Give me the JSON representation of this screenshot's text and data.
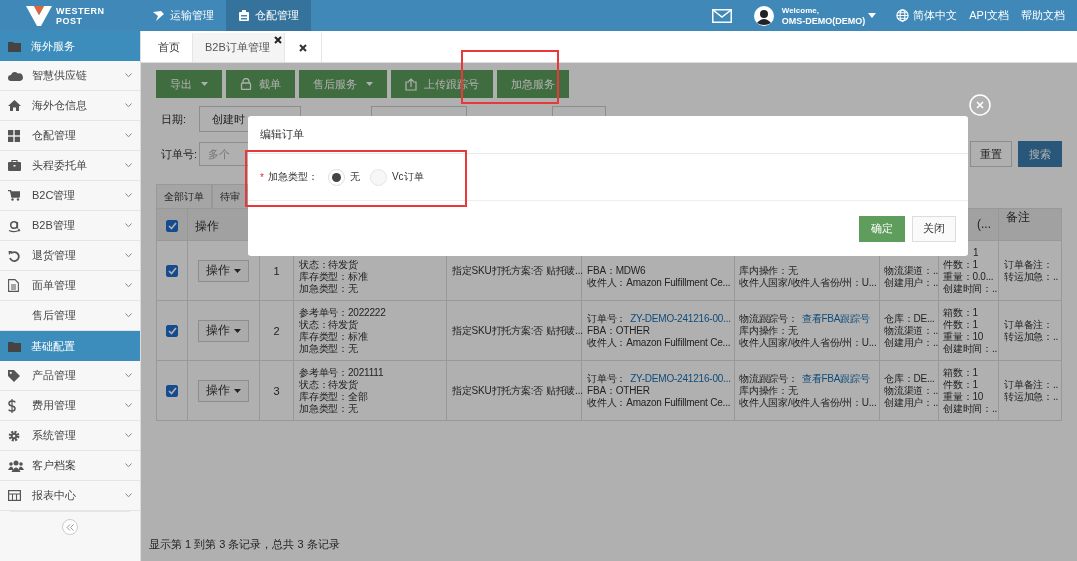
{
  "header": {
    "logo_line1": "WESTERN",
    "logo_line2": "POST",
    "nav": [
      {
        "label": "运输管理",
        "selected": false
      },
      {
        "label": "仓配管理",
        "selected": true
      }
    ],
    "welcome": "Welcome,",
    "user": "OMS-DEMO(DEMO)",
    "language": "简体中文",
    "links": [
      "API文档",
      "帮助文档"
    ]
  },
  "sidebar": {
    "groups": [
      {
        "title": "海外服务",
        "items": [
          "智慧供应链",
          "海外仓信息",
          "仓配管理",
          "头程委托单",
          "B2C管理",
          "B2B管理",
          "退货管理",
          "面单管理",
          "售后管理"
        ]
      },
      {
        "title": "基础配置",
        "items": [
          "产品管理",
          "费用管理",
          "系统管理",
          "客户档案",
          "报表中心"
        ]
      }
    ]
  },
  "tabs": [
    {
      "label": "首页",
      "selected": false,
      "closable": false
    },
    {
      "label": "B2B订单管理",
      "selected": true,
      "closable": true
    }
  ],
  "toolbar": [
    {
      "label": "导出",
      "dropdown": true
    },
    {
      "label": "截单",
      "dropdown": false
    },
    {
      "label": "售后服务",
      "dropdown": true
    },
    {
      "label": "上传跟踪号",
      "dropdown": false
    },
    {
      "label": "加急服务",
      "dropdown": false
    }
  ],
  "filters": {
    "date_label": "日期:",
    "date_type": "创建时",
    "order_label": "订单号:",
    "order_placeholder": "多个",
    "reset": "重置",
    "search": "搜索"
  },
  "status_tabs": [
    {
      "label": "全部订单"
    },
    {
      "label": "待审"
    }
  ],
  "table": {
    "header_checked": true,
    "header": {
      "actions": "操作",
      "count": "(...",
      "remark": "备注"
    },
    "rows": [
      {
        "checked": true,
        "action": "操作",
        "number": "1",
        "ref": [
          {
            "text": "状态：待发货"
          },
          {
            "text": "库存类型：标准"
          },
          {
            "text": "加急类型：无"
          }
        ],
        "sku": [
          {
            "text": "指定SKU打托方案:否 贴托唛..."
          }
        ],
        "order": [
          {
            "text": "FBA：MDW6"
          },
          {
            "text": "收件人：Amazon Fulfillment Ce..."
          }
        ],
        "logistics": [
          {
            "text": "库内操作：无"
          },
          {
            "text": "收件人国家/收件人省份/州：U..."
          }
        ],
        "warehouse": [
          {
            "text": "物流渠道：.."
          },
          {
            "text": "创建用户：.."
          }
        ],
        "counts": [
          {
            "value": "1"
          },
          {
            "label": "件数：",
            "value": "1"
          },
          {
            "label": "重量：",
            "value": "0.0..."
          },
          {
            "label": "创建时间：",
            "value": ".."
          }
        ],
        "remark": [
          {
            "text": "订单备注："
          },
          {
            "text": "转运加急：.."
          }
        ]
      },
      {
        "checked": true,
        "action": "操作",
        "number": "2",
        "ref": [
          {
            "text": "参考单号：2022222"
          },
          {
            "text": "状态：待发货"
          },
          {
            "text": "库存类型：标准"
          },
          {
            "text": "加急类型：无"
          }
        ],
        "sku": [
          {
            "text": "指定SKU打托方案:否 贴托唛..."
          }
        ],
        "order": [
          {
            "text": "订单号：",
            "link": "ZY-DEMO-241216-00..."
          },
          {
            "text": "FBA：OTHER"
          },
          {
            "text": "收件人：Amazon Fulfillment Ce..."
          }
        ],
        "logistics": [
          {
            "text": "物流跟踪号：",
            "link": "查看FBA跟踪号"
          },
          {
            "text": "库内操作：无"
          },
          {
            "text": "收件人国家/收件人省份/州：U..."
          }
        ],
        "warehouse": [
          {
            "text": "仓库：DE..."
          },
          {
            "text": "物流渠道：.."
          },
          {
            "text": "创建用户：.."
          }
        ],
        "counts": [
          {
            "label": "箱数：",
            "value": "1"
          },
          {
            "label": "件数：",
            "value": "1"
          },
          {
            "label": "重量：",
            "value": "10"
          },
          {
            "label": "创建时间：",
            "value": ".."
          }
        ],
        "remark": [
          {
            "text": "订单备注："
          },
          {
            "text": "转运加急：.."
          }
        ]
      },
      {
        "checked": true,
        "action": "操作",
        "number": "3",
        "ref": [
          {
            "text": "参考单号：2021111"
          },
          {
            "text": "状态：待发货"
          },
          {
            "text": "库存类型：全部"
          },
          {
            "text": "加急类型：无"
          }
        ],
        "sku": [
          {
            "text": "指定SKU打托方案:否 贴托唛..."
          }
        ],
        "order": [
          {
            "text": "订单号：",
            "link": "ZY-DEMO-241216-00..."
          },
          {
            "text": "FBA：OTHER"
          },
          {
            "text": "收件人：Amazon Fulfillment Ce..."
          }
        ],
        "logistics": [
          {
            "text": "物流跟踪号：",
            "link": "查看FBA跟踪号"
          },
          {
            "text": "库内操作：无"
          },
          {
            "text": "收件人国家/收件人省份/州：U..."
          }
        ],
        "warehouse": [
          {
            "text": "仓库：DE..."
          },
          {
            "text": "物流渠道：.."
          },
          {
            "text": "创建用户：.."
          }
        ],
        "counts": [
          {
            "label": "箱数：",
            "value": "1"
          },
          {
            "label": "件数：",
            "value": "1"
          },
          {
            "label": "重量：",
            "value": "10"
          },
          {
            "label": "创建时间：",
            "value": ".."
          }
        ],
        "remark": [
          {
            "text": "订单备注：.."
          },
          {
            "text": "转运加急：.."
          }
        ]
      }
    ]
  },
  "footer": "显示第 1 到第 3 条记录，总共 3 条记录",
  "dialog": {
    "title": "编辑订单",
    "required_mark": "*",
    "field_label": "加急类型：",
    "options": [
      {
        "label": "无",
        "selected": true
      },
      {
        "label": "Vc订单",
        "selected": false
      }
    ],
    "confirm": "确定",
    "close": "关闭"
  }
}
